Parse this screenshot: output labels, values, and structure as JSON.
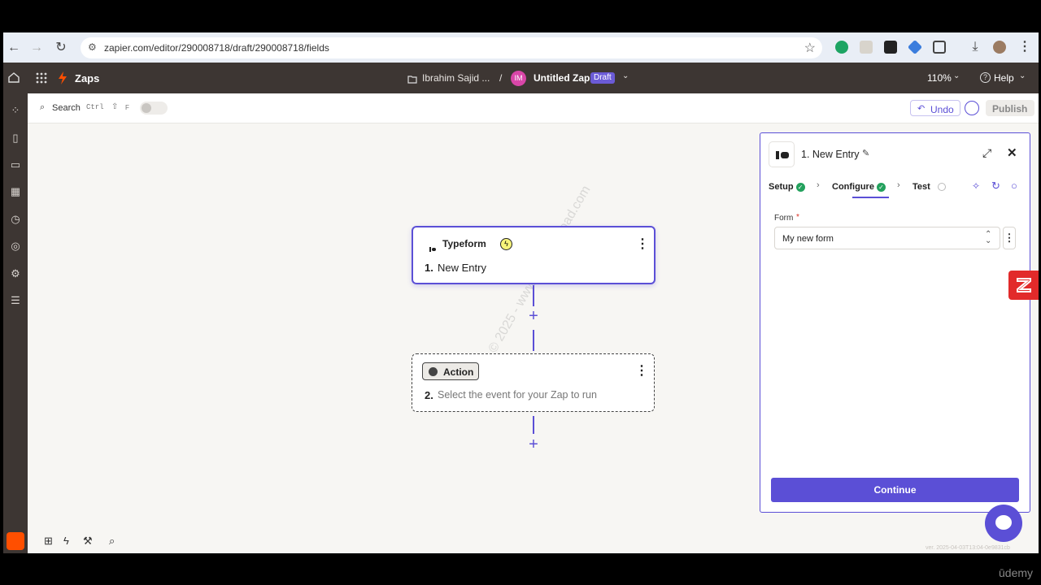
{
  "browser": {
    "url": "zapier.com/editor/290008718/draft/290008718/fields"
  },
  "header": {
    "app_name": "Zaps",
    "folder": "Ibrahim Sajid ...",
    "avatar_initials": "IM",
    "zap_title": "Untitled Zap",
    "status_badge": "Draft",
    "zoom": "110%",
    "help": "Help"
  },
  "toolbar": {
    "search_label": "Search",
    "search_shortcut_ctrl": "Ctrl",
    "search_shortcut_shift": "⇧",
    "search_shortcut_key": "F",
    "undo_label": "Undo",
    "publish_label": "Publish"
  },
  "canvas": {
    "trigger": {
      "app": "Typeform",
      "step_number": "1.",
      "event": "New Entry"
    },
    "action": {
      "badge": "Action",
      "step_number": "2.",
      "placeholder": "Select the event for your Zap to run"
    },
    "watermark": "Copyright © 2025 - www.p30download.com"
  },
  "panel": {
    "title": "1. New Entry",
    "tabs": [
      {
        "label": "Setup"
      },
      {
        "label": "Configure"
      },
      {
        "label": "Test"
      }
    ],
    "form_label": "Form",
    "required_mark": "*",
    "form_value": "My new form",
    "continue_label": "Continue"
  },
  "footer": {
    "version": "ver. 2025-04-03T13:04-0e9831cb",
    "brand": "ūdemy"
  },
  "colors": {
    "accent": "#5b4fd6",
    "header_bg": "#3d3633",
    "success": "#23a15d",
    "zapier_orange": "#ff4f00"
  }
}
